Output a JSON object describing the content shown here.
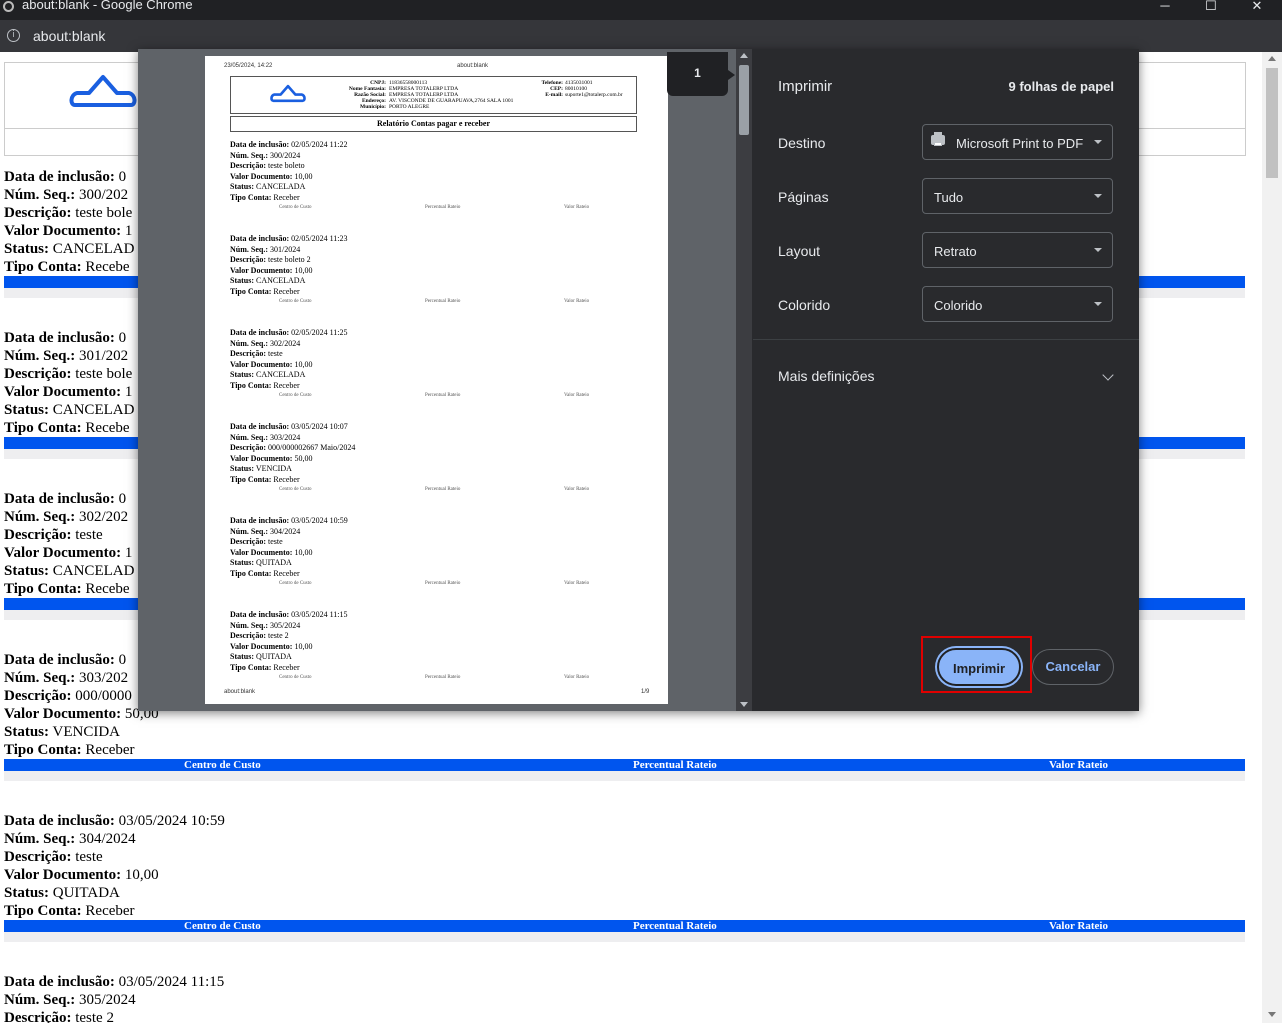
{
  "window": {
    "title": "about:blank - Google Chrome",
    "minimize": "─",
    "maximize": "☐",
    "close": "✕"
  },
  "address_bar": {
    "url": "about:blank",
    "info_icon": "i"
  },
  "report_labels": {
    "data_inclusao": "Data de inclusão:",
    "num_seq": "Núm. Seq.:",
    "descricao": "Descrição:",
    "valor_documento": "Valor Documento:",
    "status": "Status:",
    "tipo_conta": "Tipo Conta:",
    "col_centro": "Centro de Custo",
    "col_percentual": "Percentual Rateio",
    "col_valor": "Valor Rateio"
  },
  "page_records": [
    {
      "data": "0",
      "seq": "300/202",
      "desc": "teste bole",
      "valor": "1",
      "status": "CANCELAD",
      "tipo": "Recebe"
    },
    {
      "data": "0",
      "seq": "301/202",
      "desc": "teste bole",
      "valor": "1",
      "status": "CANCELAD",
      "tipo": "Recebe"
    },
    {
      "data": "0",
      "seq": "302/202",
      "desc": "teste",
      "valor": "1",
      "status": "CANCELAD",
      "tipo": "Recebe"
    },
    {
      "data": "0",
      "seq": "303/202",
      "desc": "000/0000",
      "valor": "50,00",
      "status": "VENCIDA",
      "tipo": "Receber"
    },
    {
      "data": "03/05/2024 10:59",
      "seq": "304/2024",
      "desc": "teste",
      "valor": "10,00",
      "status": "QUITADA",
      "tipo": "Receber"
    },
    {
      "data": "03/05/2024 11:15",
      "seq": "305/2024",
      "desc": "teste 2",
      "valor": "",
      "status": "",
      "tipo": ""
    }
  ],
  "preview": {
    "header_date": "23/05/2024, 14:22",
    "header_url": "about:blank",
    "footer_url": "about:blank",
    "footer_page": "1/9",
    "page_badge": "1",
    "company": {
      "cnpj_label": "CNPJ:",
      "cnpj": "11836558000113",
      "fantasia_label": "Nome Fantasia:",
      "fantasia": "EMPRESA TOTALERP LTDA",
      "razao_label": "Razão Social:",
      "razao": "EMPRESA TOTALERP LTDA",
      "endereco_label": "Endereço:",
      "endereco": "AV. VISCONDE DE GUARAPUAVA,2764 SALA 1001",
      "municipio_label": "Município:",
      "municipio": "PORTO ALEGRE",
      "telefone_label": "Telefone:",
      "telefone": "4135031001",
      "cep_label": "CEP:",
      "cep": "80010100",
      "email_label": "E-mail:",
      "email": "suporte1@totalerp.com.br"
    },
    "report_title": "Relatório Contas pagar e receber",
    "records": [
      {
        "data": "02/05/2024 11:22",
        "seq": "300/2024",
        "desc": "teste boleto",
        "valor": "10,00",
        "status": "CANCELADA",
        "tipo": "Receber"
      },
      {
        "data": "02/05/2024 11:23",
        "seq": "301/2024",
        "desc": "teste boleto 2",
        "valor": "10,00",
        "status": "CANCELADA",
        "tipo": "Receber"
      },
      {
        "data": "02/05/2024 11:25",
        "seq": "302/2024",
        "desc": "teste",
        "valor": "10,00",
        "status": "CANCELADA",
        "tipo": "Receber"
      },
      {
        "data": "03/05/2024 10:07",
        "seq": "303/2024",
        "desc": "000/000002667 Maio/2024",
        "valor": "50,00",
        "status": "VENCIDA",
        "tipo": "Receber"
      },
      {
        "data": "03/05/2024 10:59",
        "seq": "304/2024",
        "desc": "teste",
        "valor": "10,00",
        "status": "QUITADA",
        "tipo": "Receber"
      },
      {
        "data": "03/05/2024 11:15",
        "seq": "305/2024",
        "desc": "teste 2",
        "valor": "10,00",
        "status": "QUITADA",
        "tipo": "Receber"
      }
    ]
  },
  "print_settings": {
    "heading": "Imprimir",
    "sheet_count": "9 folhas de papel",
    "destino_label": "Destino",
    "destino_value": "Microsoft Print to PDF",
    "paginas_label": "Páginas",
    "paginas_value": "Tudo",
    "layout_label": "Layout",
    "layout_value": "Retrato",
    "colorido_label": "Colorido",
    "colorido_value": "Colorido",
    "more_settings": "Mais definições",
    "print_button": "Imprimir",
    "cancel_button": "Cancelar"
  },
  "colors": {
    "accent": "#8ab4f8",
    "dialog_bg": "#292a2d",
    "table_header_blue": "#0055ee",
    "highlight_red": "#e00000"
  }
}
